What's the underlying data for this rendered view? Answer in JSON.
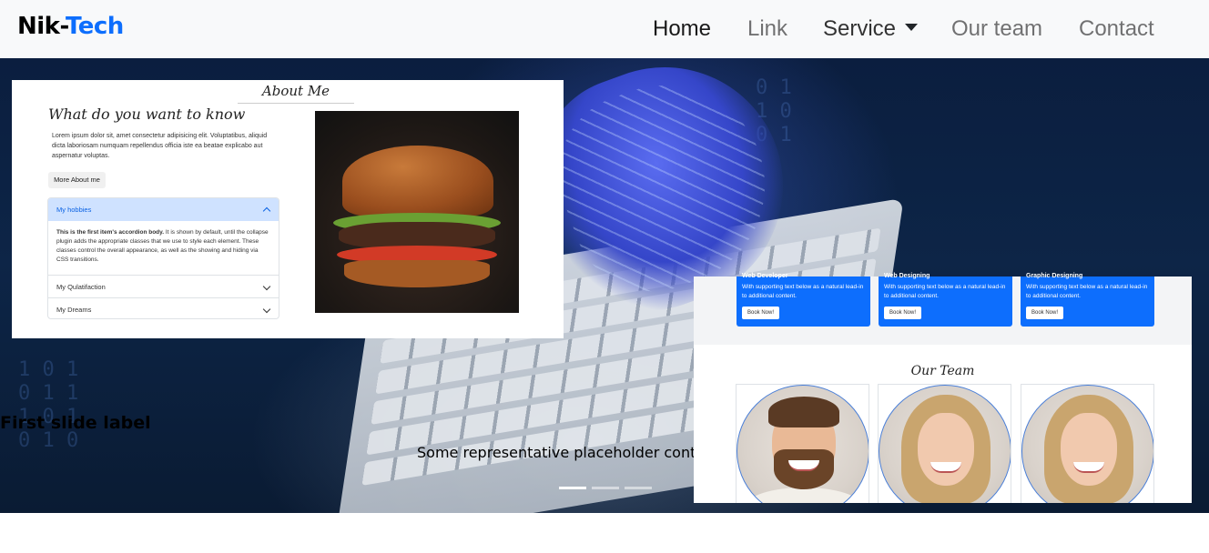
{
  "navbar": {
    "brand_part1": "Nik-",
    "brand_part2": "Tech",
    "brand_accent_color": "#0d6efd",
    "items": [
      {
        "label": "Home",
        "active": true
      },
      {
        "label": "Link"
      },
      {
        "label": "Service",
        "dropdown": true
      },
      {
        "label": "Our team"
      },
      {
        "label": "Contact"
      }
    ]
  },
  "carousel": {
    "title": "First slide label",
    "text": "Some representative placeholder content fo",
    "indicators": 3,
    "active_index": 0
  },
  "about": {
    "title": "About Me",
    "heading": "What do you want to know",
    "body": "Lorem ipsum dolor sit, amet consectetur adipisicing elit. Voluptatibus, aliquid dicta laboriosam numquam repellendus officia iste ea beatae explicabo aut aspernatur voluptas.",
    "button": "More About me",
    "accordion": [
      {
        "label": "My hobbies",
        "open": true
      },
      {
        "label": "My Qulatifaction"
      },
      {
        "label": "My Dreams"
      }
    ],
    "accordion_body_bold": "This is the first item's accordion body.",
    "accordion_body": " It is shown by default, until the collapse plugin adds the appropriate classes that we use to style each element. These classes control the overall appearance, as well as the showing and hiding via CSS transitions.",
    "image": "burger-image"
  },
  "services": [
    {
      "title": "Web Developer",
      "text": "With supporting text below as a natural lead-in to additional content.",
      "button": "Book Now!"
    },
    {
      "title": "Web Designing",
      "text": "With supporting text below as a natural lead-in to additional content.",
      "button": "Book Now!"
    },
    {
      "title": "Graphic Designing",
      "text": "With supporting text below as a natural lead-in to additional content.",
      "button": "Book Now!"
    }
  ],
  "team": {
    "title": "Our Team",
    "members": [
      "man-avatar",
      "woman-avatar",
      "woman-avatar"
    ]
  }
}
